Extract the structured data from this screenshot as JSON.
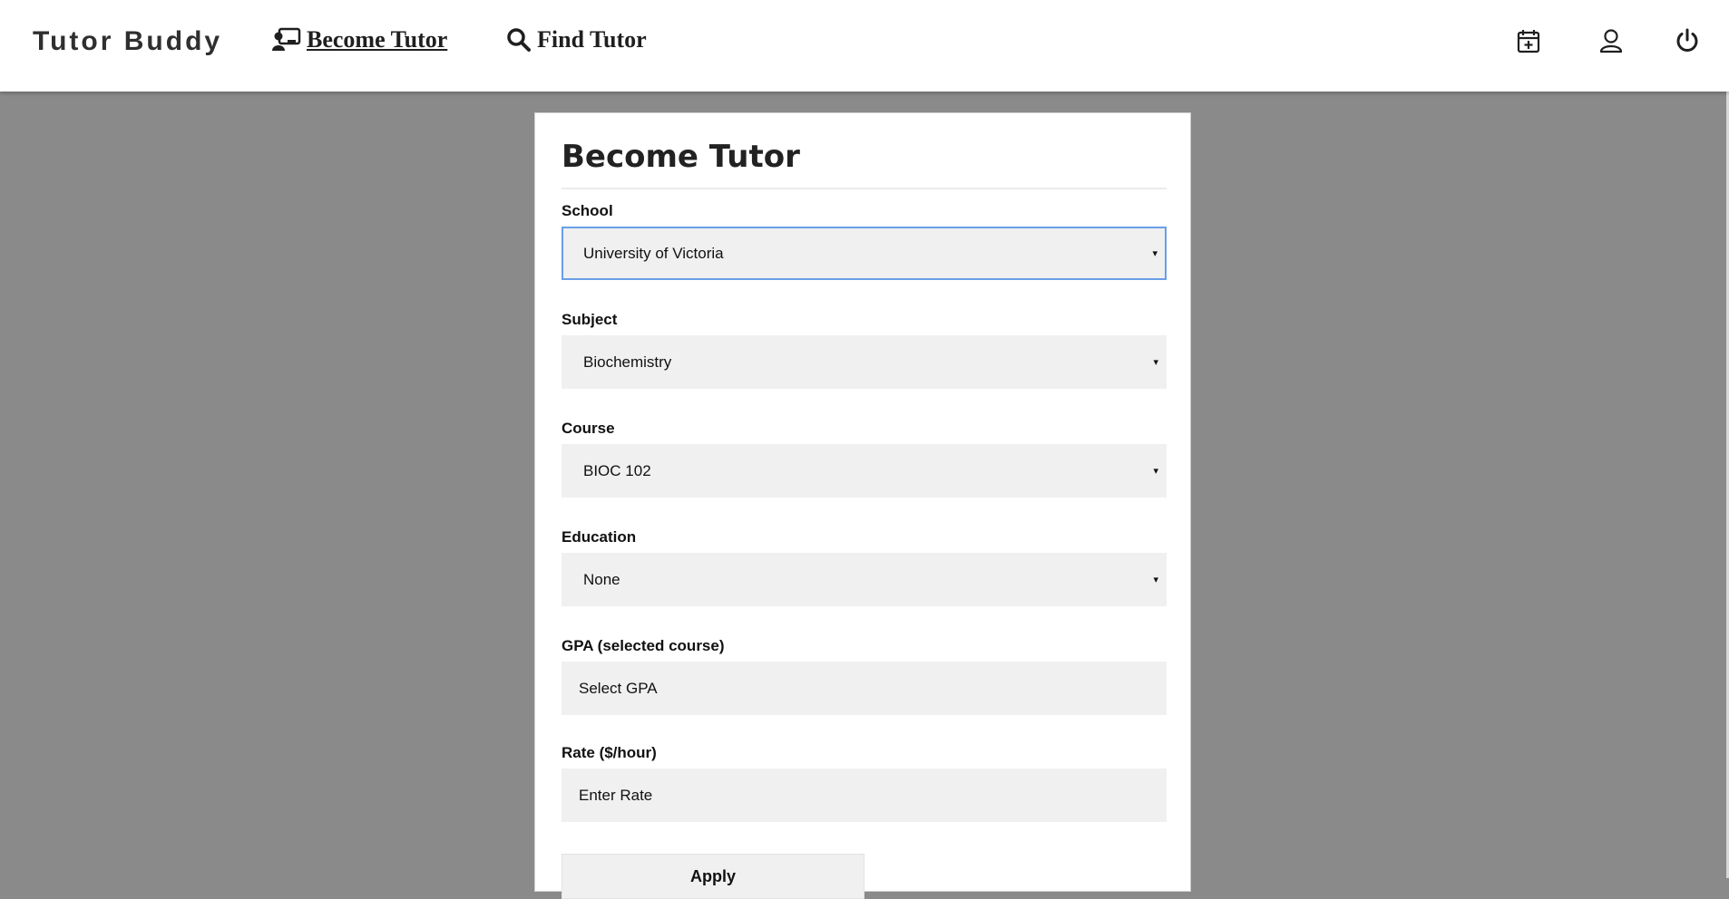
{
  "app": {
    "brand": "Tutor Buddy"
  },
  "nav": {
    "become_tutor": "Become Tutor",
    "find_tutor": "Find Tutor",
    "icons": [
      "calendar-plus-icon",
      "user-icon",
      "power-icon"
    ]
  },
  "form": {
    "title": "Become Tutor",
    "school": {
      "label": "School",
      "value": "University of Victoria"
    },
    "subject": {
      "label": "Subject",
      "value": "Biochemistry"
    },
    "course": {
      "label": "Course",
      "value": "BIOC 102"
    },
    "education": {
      "label": "Education",
      "value": "None"
    },
    "gpa": {
      "label": "GPA (selected course)",
      "placeholder": "Select GPA"
    },
    "rate": {
      "label": "Rate ($/hour)",
      "placeholder": "Enter Rate"
    },
    "apply_label": "Apply"
  },
  "colors": {
    "background": "#8b8a8b",
    "field_bg": "#f0f0f0",
    "focus_border": "#6a9ee8"
  }
}
